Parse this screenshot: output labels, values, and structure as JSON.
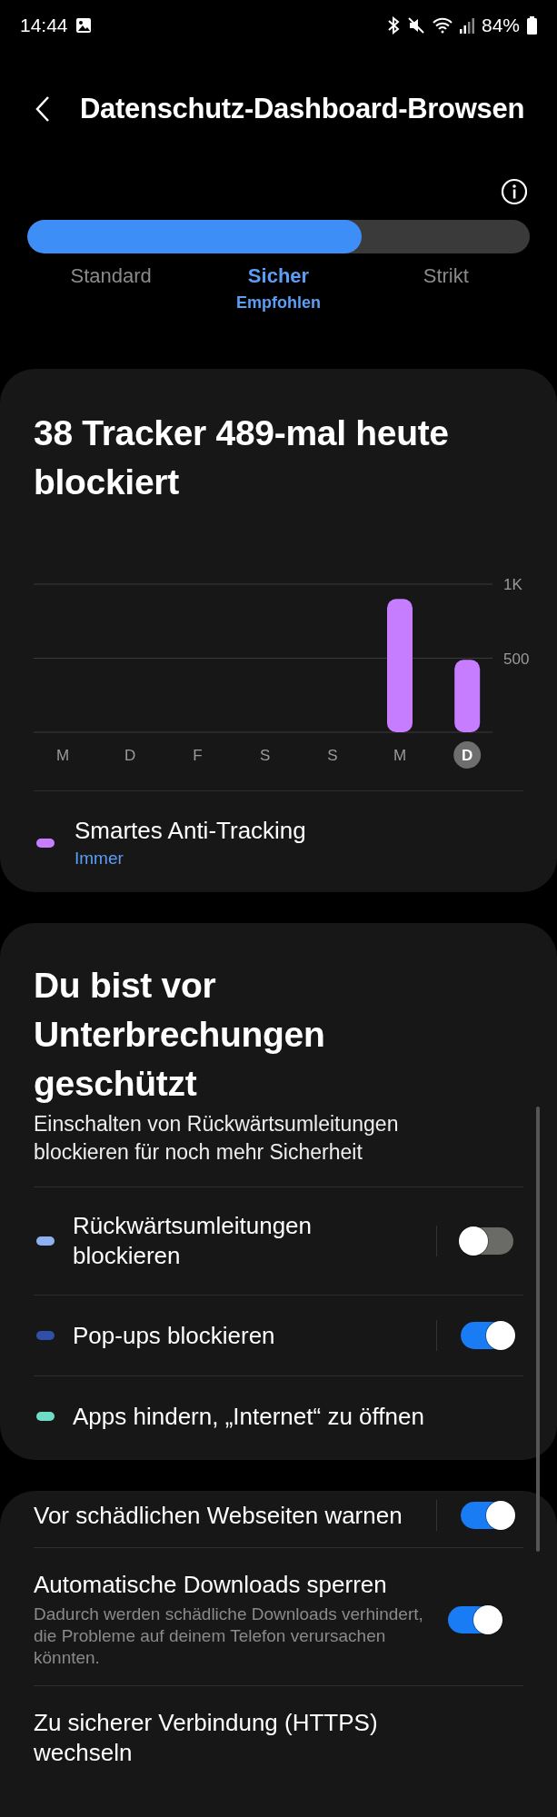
{
  "status_bar": {
    "time": "14:44",
    "battery": "84%"
  },
  "header": {
    "title": "Datenschutz-Dashboard-Browsen"
  },
  "protection_level": {
    "level": 0.665,
    "options": [
      {
        "label": "Standard",
        "selected": false
      },
      {
        "label": "Sicher",
        "selected": true,
        "note": "Empfohlen"
      },
      {
        "label": "Strikt",
        "selected": false
      }
    ]
  },
  "tracker_card": {
    "title": "38 Tracker 489-mal heute blockiert",
    "chart_data": {
      "type": "bar",
      "categories": [
        "M",
        "D",
        "F",
        "S",
        "S",
        "M",
        "D"
      ],
      "values": [
        0,
        0,
        0,
        0,
        0,
        900,
        489
      ],
      "ylim": [
        0,
        1000
      ],
      "yticks": [
        {
          "value": 500,
          "label": "500"
        },
        {
          "value": 1000,
          "label": "1K"
        }
      ]
    },
    "category_states": [
      {
        "selected": false
      },
      {
        "selected": false
      },
      {
        "selected": false
      },
      {
        "selected": false
      },
      {
        "selected": false
      },
      {
        "selected": false
      },
      {
        "selected": true
      }
    ],
    "legend": [
      {
        "label": "Smartes Anti-Tracking",
        "subtitle": "Immer",
        "color": "#c77dff"
      }
    ]
  },
  "interruptions_card": {
    "title": "Du bist vor Unterbrechungen geschützt",
    "description": "Einschalten von Rückwärtsumleitungen blockieren für noch mehr Sicherheit",
    "items": [
      {
        "kind": "toggle",
        "label": "Rückwärtsumleitungen blockieren",
        "color": "#8fb0f0",
        "on": false
      },
      {
        "kind": "toggle",
        "label": "Pop-ups blockieren",
        "color": "#2f4fa8",
        "on": true
      },
      {
        "kind": "plain",
        "label": "Apps hindern, „Internet“ zu öffnen",
        "color": "#6fdcc6"
      }
    ]
  },
  "settings": [
    {
      "kind": "toggle",
      "label": "Vor schädlichen Webseiten warnen",
      "on": true
    },
    {
      "kind": "toggle",
      "label": "Automatische Downloads sperren",
      "subtitle": "Dadurch werden schädliche Downloads verhindert, die Probleme auf deinem Telefon verursachen könnten.",
      "on": true
    },
    {
      "kind": "plain",
      "label": "Zu sicherer Verbindung (HTTPS) wechseln"
    }
  ]
}
